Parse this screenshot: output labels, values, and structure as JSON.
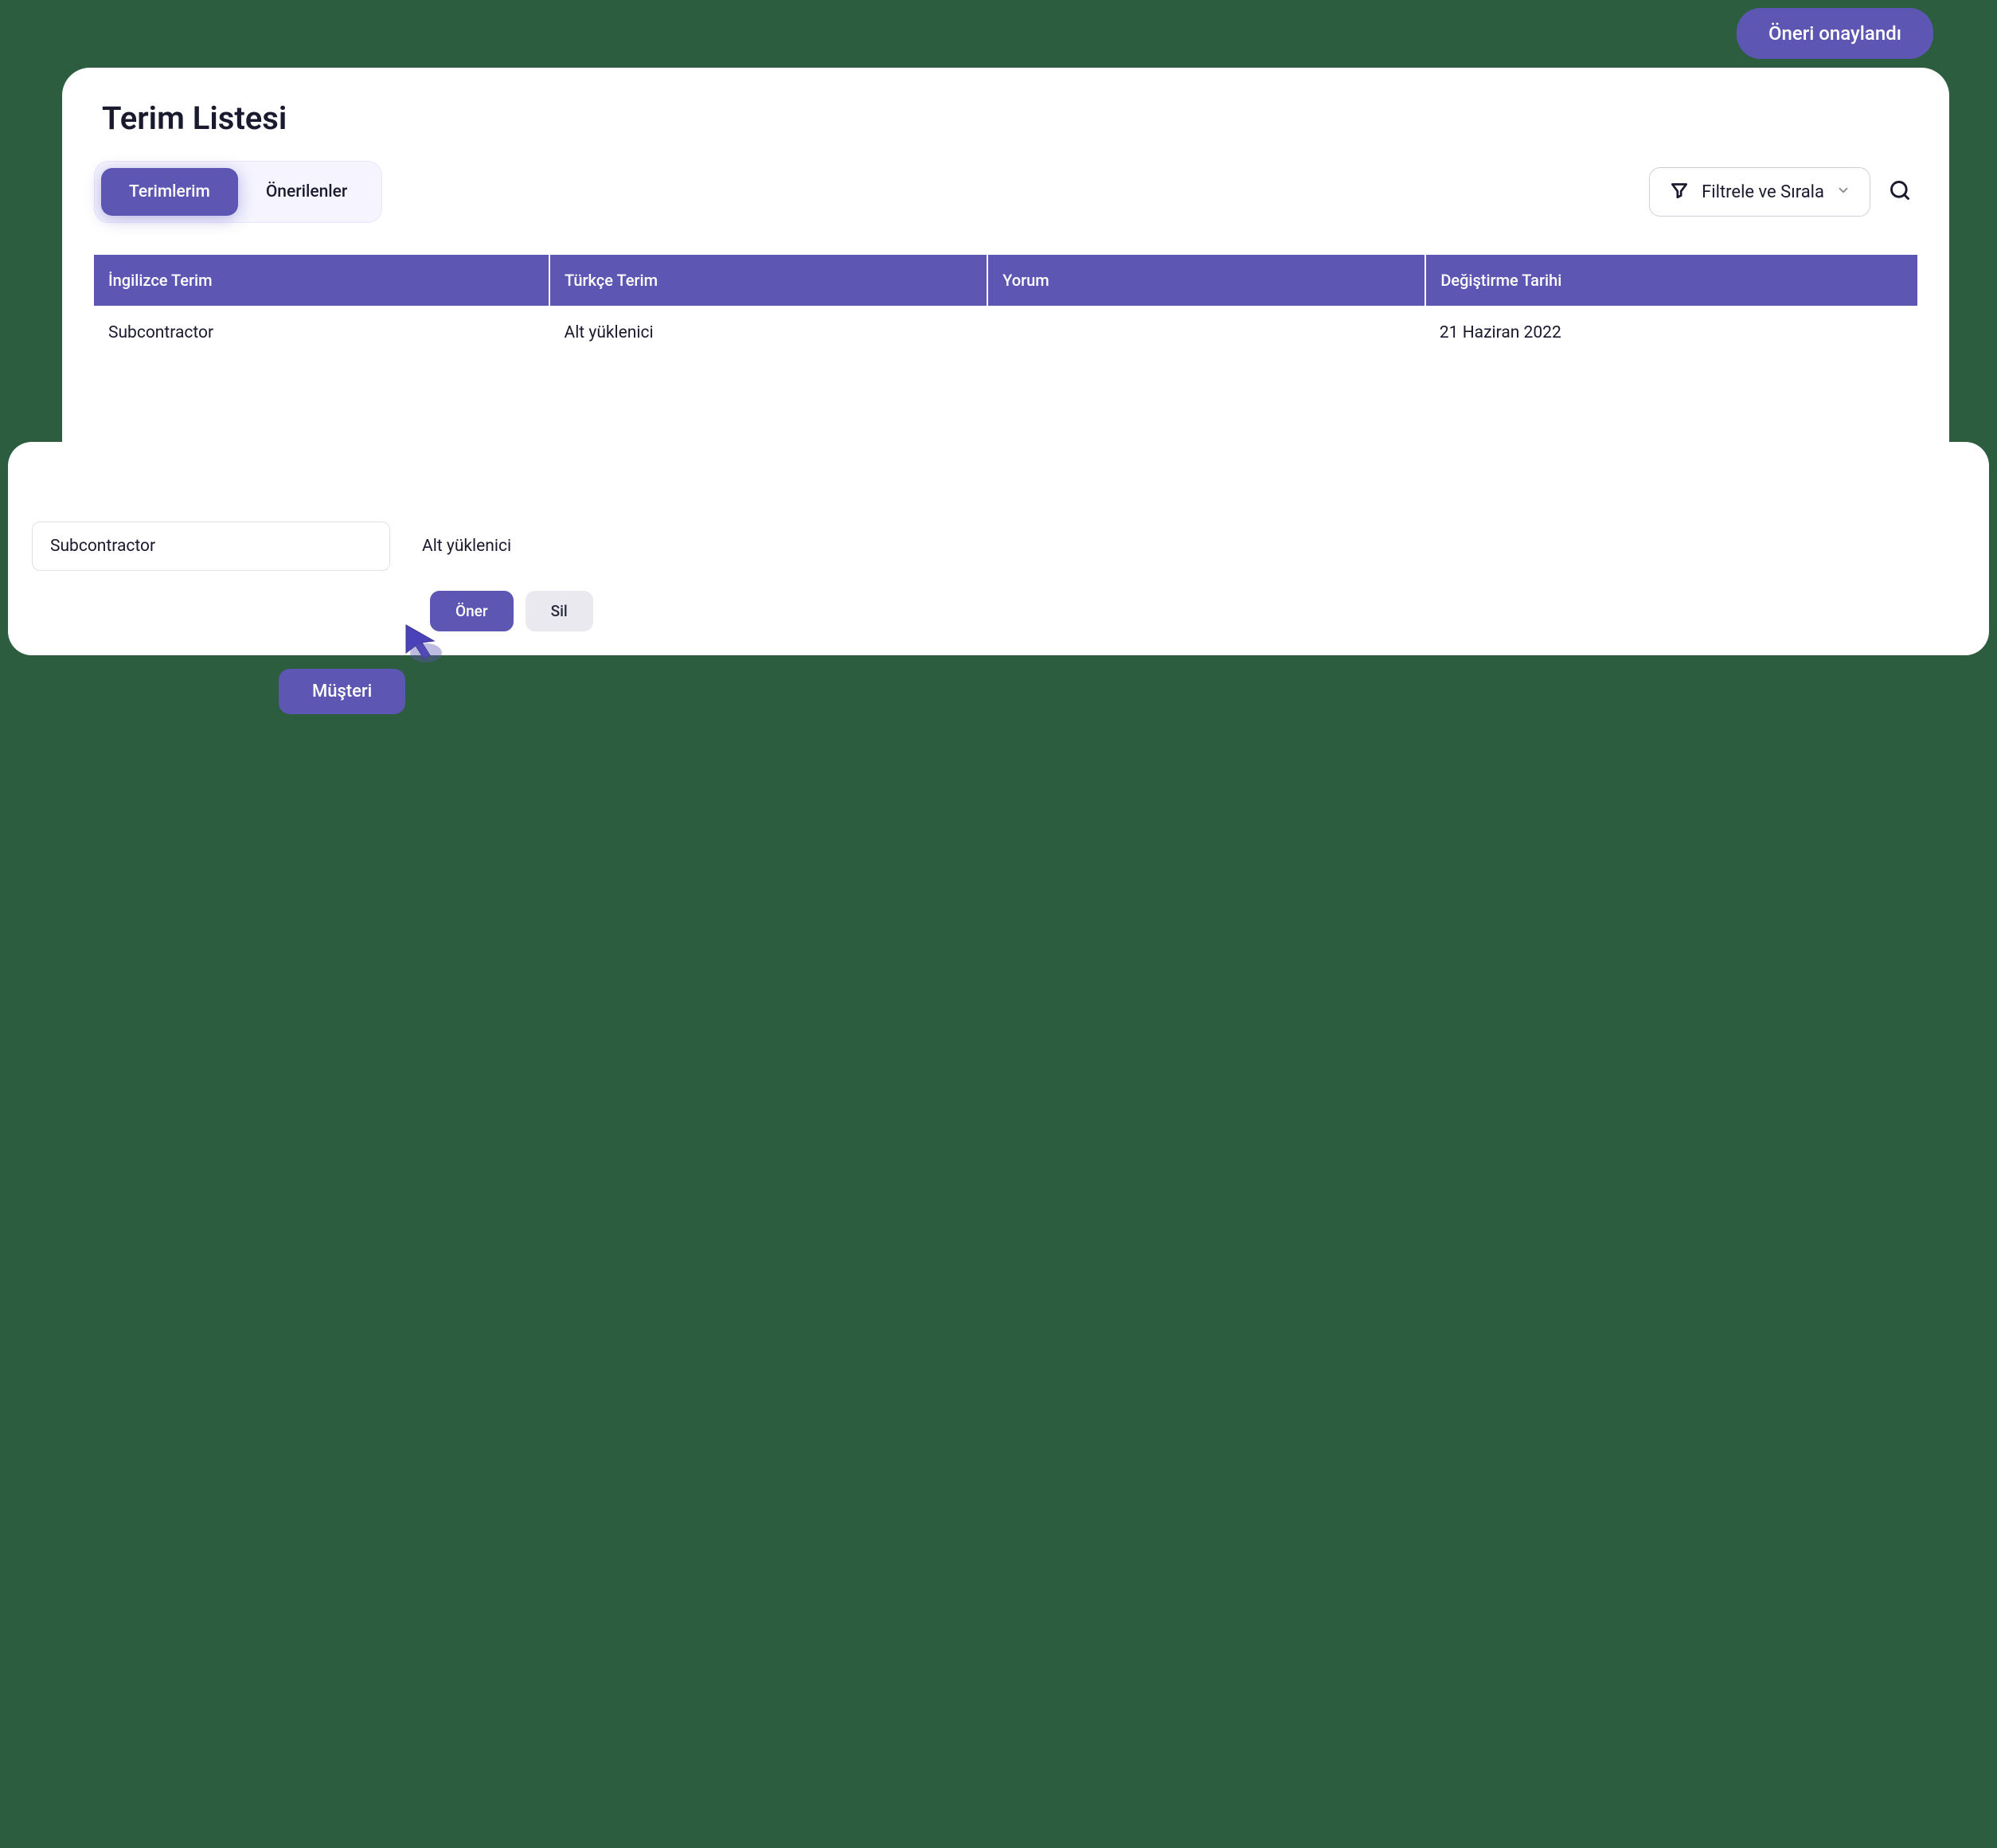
{
  "toast": {
    "message": "Öneri onaylandı"
  },
  "main": {
    "title": "Terim Listesi",
    "tabs": [
      {
        "label": "Terimlerim",
        "active": true
      },
      {
        "label": "Önerilenler",
        "active": false
      }
    ],
    "filter": {
      "label": "Filtrele ve Sırala"
    },
    "table": {
      "headers": {
        "english": "İngilizce Terim",
        "turkish": "Türkçe Terim",
        "comment": "Yorum",
        "date": "Değiştirme Tarihi"
      },
      "rows": [
        {
          "english": "Subcontractor",
          "turkish": "Alt yüklenici",
          "comment": "",
          "date": "21 Haziran 2022"
        }
      ]
    }
  },
  "bottom": {
    "source_input": "Subcontractor",
    "target_text": "Alt yüklenici",
    "suggest_button": "Öner",
    "delete_button": "Sil"
  },
  "cursor": {
    "label": "Müşteri"
  }
}
